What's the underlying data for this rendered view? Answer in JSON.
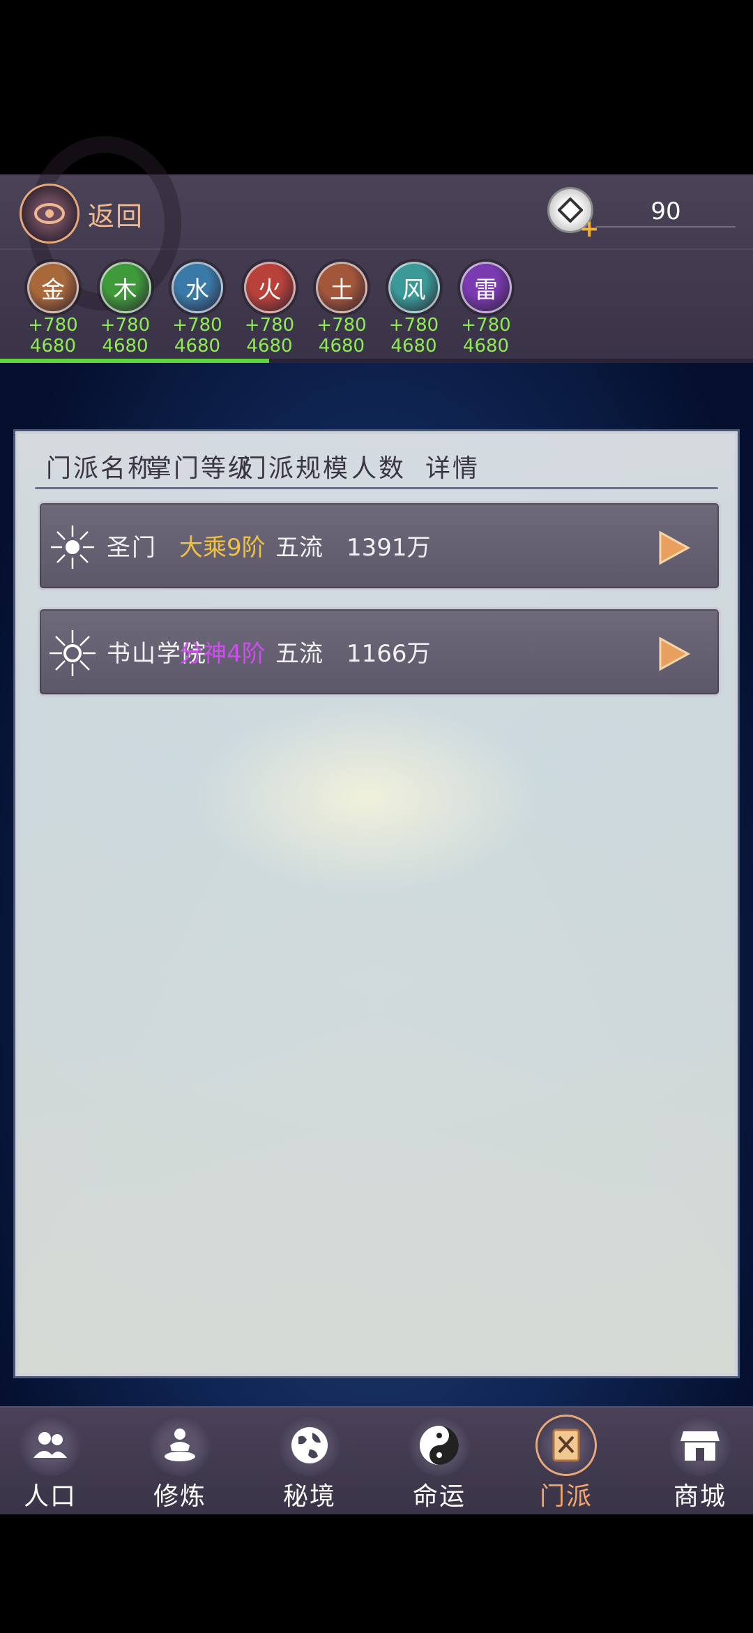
{
  "header": {
    "back_label": "返回",
    "currency_value": "90"
  },
  "elements": [
    {
      "glyph": "金",
      "gain": "+780",
      "total": "4680",
      "color": "#a8683a"
    },
    {
      "glyph": "木",
      "gain": "+780",
      "total": "4680",
      "color": "#3f9a3a"
    },
    {
      "glyph": "水",
      "gain": "+780",
      "total": "4680",
      "color": "#3a7aa8"
    },
    {
      "glyph": "火",
      "gain": "+780",
      "total": "4680",
      "color": "#b8423a"
    },
    {
      "glyph": "土",
      "gain": "+780",
      "total": "4680",
      "color": "#a2563a"
    },
    {
      "glyph": "风",
      "gain": "+780",
      "total": "4680",
      "color": "#3a9a98"
    },
    {
      "glyph": "雷",
      "gain": "+780",
      "total": "4680",
      "color": "#7a3ab0"
    }
  ],
  "progress_fraction": 0.357,
  "table": {
    "columns": [
      "门派名称",
      "掌门等级",
      "门派规模",
      "人数",
      "详情"
    ],
    "rows": [
      {
        "name": "圣门",
        "level": "大乘9阶",
        "level_color": "#f0c040",
        "scale": "五流",
        "count": "1391万"
      },
      {
        "name": "书山学院",
        "level": "分神4阶",
        "level_color": "#d04cf0",
        "scale": "五流",
        "count": "1166万"
      }
    ]
  },
  "nav": [
    {
      "label": "人口",
      "icon": "people-icon"
    },
    {
      "label": "修炼",
      "icon": "meditation-icon"
    },
    {
      "label": "秘境",
      "icon": "globe-icon"
    },
    {
      "label": "命运",
      "icon": "yin-yang-icon"
    },
    {
      "label": "门派",
      "icon": "sect-book-icon",
      "active": true
    },
    {
      "label": "商城",
      "icon": "shop-icon"
    }
  ]
}
